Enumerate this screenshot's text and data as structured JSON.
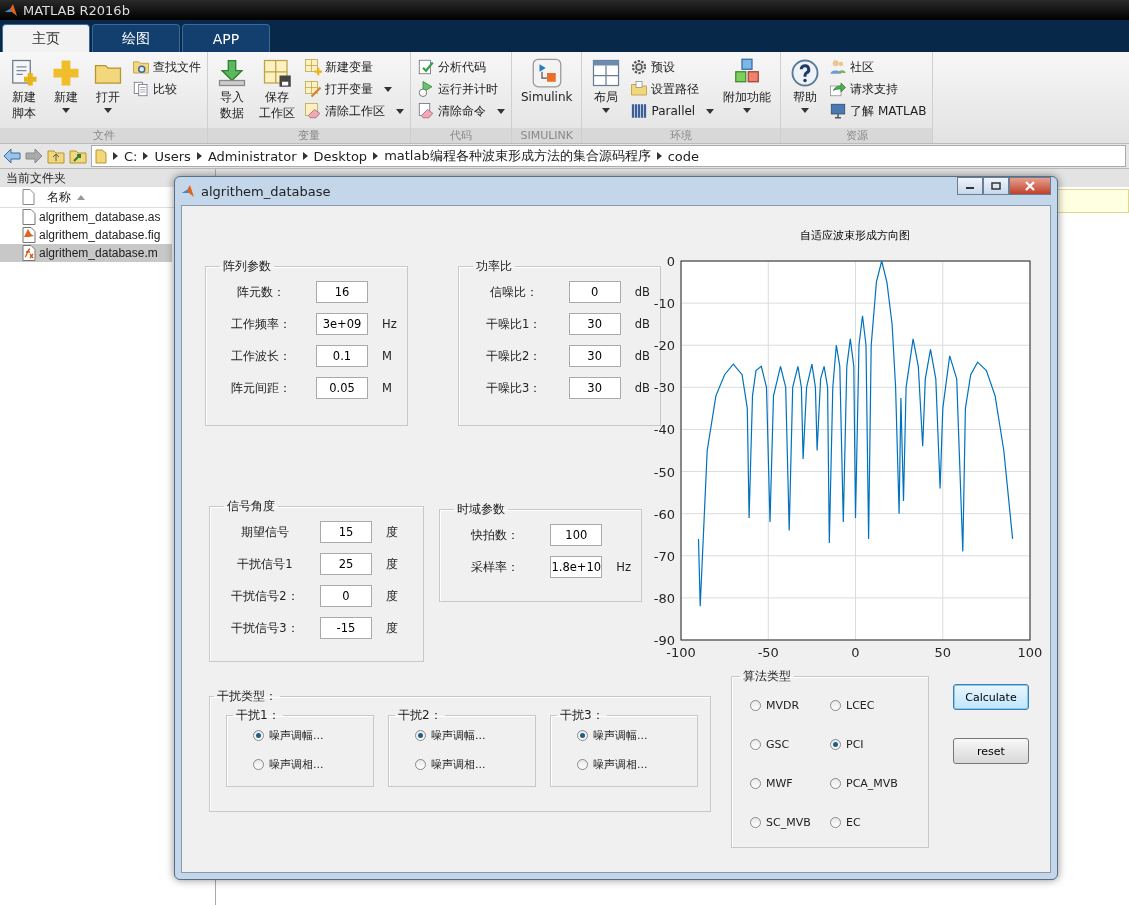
{
  "window": {
    "title": "MATLAB R2016b"
  },
  "tabs": [
    {
      "label": "主页",
      "selected": true
    },
    {
      "label": "绘图",
      "selected": false
    },
    {
      "label": "APP",
      "selected": false
    }
  ],
  "ribbon": [
    {
      "label": "文件",
      "items": [
        {
          "kind": "large",
          "lines": [
            "新建",
            "脚本"
          ],
          "dropdown": false
        },
        {
          "kind": "large",
          "lines": [
            "新建"
          ],
          "dropdown": true
        },
        {
          "kind": "large",
          "lines": [
            "打开"
          ],
          "dropdown": true
        },
        {
          "kind": "small",
          "label": "查找文件",
          "dropdown": false
        },
        {
          "kind": "small",
          "label": "比较",
          "dropdown": false
        }
      ]
    },
    {
      "label": "变量",
      "items": [
        {
          "kind": "large",
          "lines": [
            "导入",
            "数据"
          ],
          "dropdown": false
        },
        {
          "kind": "large",
          "lines": [
            "保存",
            "工作区"
          ],
          "dropdown": false
        },
        {
          "kind": "small",
          "label": "新建变量",
          "dropdown": false
        },
        {
          "kind": "small",
          "label": "打开变量",
          "dropdown": true
        },
        {
          "kind": "small",
          "label": "清除工作区",
          "dropdown": true
        }
      ]
    },
    {
      "label": "代码",
      "items": [
        {
          "kind": "small",
          "label": "分析代码",
          "dropdown": false
        },
        {
          "kind": "small",
          "label": "运行并计时",
          "dropdown": false
        },
        {
          "kind": "small",
          "label": "清除命令",
          "dropdown": true
        }
      ]
    },
    {
      "label": "SIMULINK",
      "items": [
        {
          "kind": "large",
          "lines": [
            "Simulink"
          ],
          "dropdown": false
        }
      ]
    },
    {
      "label": "环境",
      "items": [
        {
          "kind": "large",
          "lines": [
            "布局"
          ],
          "dropdown": true
        },
        {
          "kind": "small",
          "label": "预设",
          "dropdown": false
        },
        {
          "kind": "small",
          "label": "设置路径",
          "dropdown": false
        },
        {
          "kind": "small",
          "label": "Parallel",
          "dropdown": true
        },
        {
          "kind": "large",
          "lines": [
            "附加功能"
          ],
          "dropdown": true
        }
      ]
    },
    {
      "label": "资源",
      "items": [
        {
          "kind": "large",
          "lines": [
            "帮助"
          ],
          "dropdown": true
        },
        {
          "kind": "small",
          "label": "社区",
          "dropdown": false
        },
        {
          "kind": "small",
          "label": "请求支持",
          "dropdown": false
        },
        {
          "kind": "small",
          "label": "了解 MATLAB",
          "dropdown": false
        }
      ]
    }
  ],
  "address_bar": {
    "path": [
      "C:",
      "Users",
      "Administrator",
      "Desktop",
      "matlab编程各种波束形成方法的集合源码程序",
      "code"
    ]
  },
  "current_folder": {
    "title": "当前文件夹",
    "column": "名称",
    "files": [
      {
        "name": "algrithem_database.as",
        "kind": "text",
        "selected": false
      },
      {
        "name": "algrithem_database.fig",
        "kind": "figure",
        "selected": false
      },
      {
        "name": "algrithem_database.m",
        "kind": "script",
        "selected": true
      }
    ]
  },
  "figure_window": {
    "title": "algrithem_database",
    "array_params": {
      "title": "阵列参数",
      "rows": [
        {
          "label": "阵元数：",
          "value": "16"
        },
        {
          "label": "工作频率：",
          "value": "3e+09",
          "unit": "Hz"
        },
        {
          "label": "工作波长：",
          "value": "0.1",
          "unit": "M"
        },
        {
          "label": "阵元间距：",
          "value": "0.05",
          "unit": "M"
        }
      ]
    },
    "power_ratio": {
      "title": "功率比",
      "rows": [
        {
          "label": "信噪比：",
          "value": "0",
          "unit": "dB"
        },
        {
          "label": "干噪比1：",
          "value": "30",
          "unit": "dB"
        },
        {
          "label": "干噪比2：",
          "value": "30",
          "unit": "dB"
        },
        {
          "label": "干噪比3：",
          "value": "30",
          "unit": "dB"
        }
      ]
    },
    "signal_angles": {
      "title": "信号角度",
      "rows": [
        {
          "label": "期望信号",
          "value": "15",
          "unit": "度"
        },
        {
          "label": "干扰信号1",
          "value": "25",
          "unit": "度"
        },
        {
          "label": "干扰信号2：",
          "value": "0",
          "unit": "度"
        },
        {
          "label": "干扰信号3：",
          "value": "-15",
          "unit": "度"
        }
      ]
    },
    "time_params": {
      "title": "时域参数",
      "rows": [
        {
          "label": "快拍数：",
          "value": "100"
        },
        {
          "label": "采样率：",
          "value": "1.8e+10",
          "unit": "Hz"
        }
      ]
    },
    "chart": {
      "chart_data": {
        "type": "line",
        "title": "自适应波束形成方向图",
        "xlim": [
          -100,
          100
        ],
        "ylim": [
          -90,
          0
        ],
        "xticks": [
          -100,
          -50,
          0,
          50,
          100
        ],
        "yticks": [
          0,
          -10,
          -20,
          -30,
          -40,
          -50,
          -60,
          -70,
          -80,
          -90
        ],
        "x": [
          -90,
          -89,
          -85,
          -80,
          -75,
          -70,
          -65,
          -62,
          -61,
          -59,
          -57,
          -54,
          -51,
          -49,
          -47,
          -43,
          -40,
          -38,
          -36,
          -33,
          -31,
          -30,
          -28,
          -25,
          -23,
          -22,
          -20,
          -18,
          -16,
          -15,
          -13,
          -11,
          -9,
          -7,
          -5,
          -3,
          -1,
          0,
          2,
          4,
          6,
          7.5,
          9,
          12,
          15,
          18,
          21,
          23,
          25,
          26,
          27.5,
          29,
          33,
          36,
          38.5,
          40,
          43,
          46,
          48.5,
          50,
          54,
          58,
          61.5,
          63,
          66,
          70,
          75,
          80,
          85,
          90
        ],
        "grid": true,
        "series": [
          {
            "color": "#0072bd",
            "values": [
              -66,
              -82,
              -45,
              -32,
              -27,
              -24.5,
              -27,
              -35,
              -61,
              -32,
              -26,
              -25,
              -30,
              -62,
              -32,
              -25,
              -30,
              -64,
              -30,
              -25,
              -30,
              -47,
              -30,
              -24.5,
              -30,
              -45,
              -28,
              -25,
              -30,
              -67,
              -30,
              -20,
              -25,
              -62,
              -25,
              -18.5,
              -25,
              -61,
              -20,
              -13,
              -20,
              -66,
              -20,
              -5,
              0,
              -5,
              -15,
              -30,
              -60,
              -32.5,
              -57,
              -30,
              -18.5,
              -25,
              -44,
              -28,
              -21,
              -28,
              -54,
              -35,
              -22.5,
              -28,
              -69,
              -35,
              -27,
              -24,
              -26,
              -32,
              -45,
              -66
            ]
          }
        ]
      }
    },
    "interference_types": {
      "title": "干扰类型：",
      "groups": [
        {
          "title": "干扰1：",
          "options": [
            {
              "label": "噪声调幅...",
              "selected": true
            },
            {
              "label": "噪声调相...",
              "selected": false
            }
          ]
        },
        {
          "title": "干扰2：",
          "options": [
            {
              "label": "噪声调幅...",
              "selected": true
            },
            {
              "label": "噪声调相...",
              "selected": false
            }
          ]
        },
        {
          "title": "干扰3：",
          "options": [
            {
              "label": "噪声调幅...",
              "selected": true
            },
            {
              "label": "噪声调相...",
              "selected": false
            }
          ]
        }
      ]
    },
    "algorithm_types": {
      "title": "算法类型",
      "options": [
        {
          "label": "MVDR",
          "selected": false
        },
        {
          "label": "LCEC",
          "selected": false
        },
        {
          "label": "GSC",
          "selected": false
        },
        {
          "label": "PCI",
          "selected": true
        },
        {
          "label": "MWF",
          "selected": false
        },
        {
          "label": "PCA_MVB",
          "selected": false
        },
        {
          "label": "SC_MVB",
          "selected": false
        },
        {
          "label": "EC",
          "selected": false
        }
      ]
    },
    "buttons": [
      {
        "label": "Calculate",
        "default": true
      },
      {
        "label": "reset",
        "default": false
      }
    ]
  }
}
